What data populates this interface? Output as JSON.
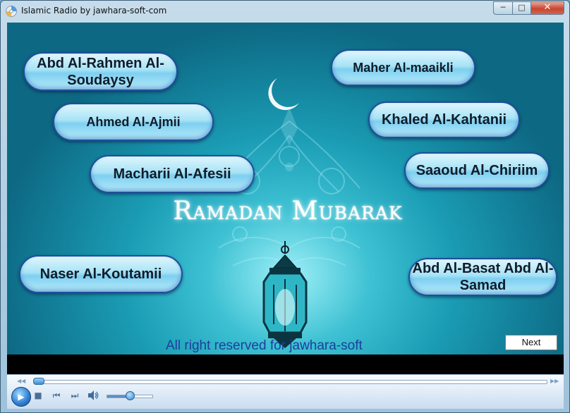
{
  "window": {
    "title": "Islamic Radio by jawhara-soft-com",
    "controls": {
      "minimize": "─",
      "maximize": "□",
      "close": "✕"
    }
  },
  "reciters": [
    {
      "id": "soudaysy",
      "label": "Abd Al-Rahmen Al-Soudaysy"
    },
    {
      "id": "maaikli",
      "label": "Maher Al-maaikli"
    },
    {
      "id": "ajmii",
      "label": "Ahmed Al-Ajmii"
    },
    {
      "id": "kahtanii",
      "label": "Khaled Al-Kahtanii"
    },
    {
      "id": "afesii",
      "label": "Macharii Al-Afesii"
    },
    {
      "id": "chiriim",
      "label": "Saaoud Al-Chiriim"
    },
    {
      "id": "koutamii",
      "label": "Naser Al-Koutamii"
    },
    {
      "id": "samad",
      "label": "Abd Al-Basat Abd Al-Samad"
    }
  ],
  "banner": {
    "headline": "Ramadan Mubarak"
  },
  "footer": {
    "copyright": "All right reserved for jawhara-soft",
    "next_label": "Next"
  },
  "player": {
    "icons": {
      "play": "play-icon",
      "stop": "stop-icon",
      "previous": "previous-icon",
      "next": "next-track-icon",
      "mute": "speaker-icon"
    },
    "seek_progress": 0.01,
    "volume_level": 0.5
  },
  "colors": {
    "accent": "#1f4f9a",
    "background_dark": "#0d6883",
    "background_glow": "#9ff0f8",
    "text_link": "#1d3f9c"
  }
}
